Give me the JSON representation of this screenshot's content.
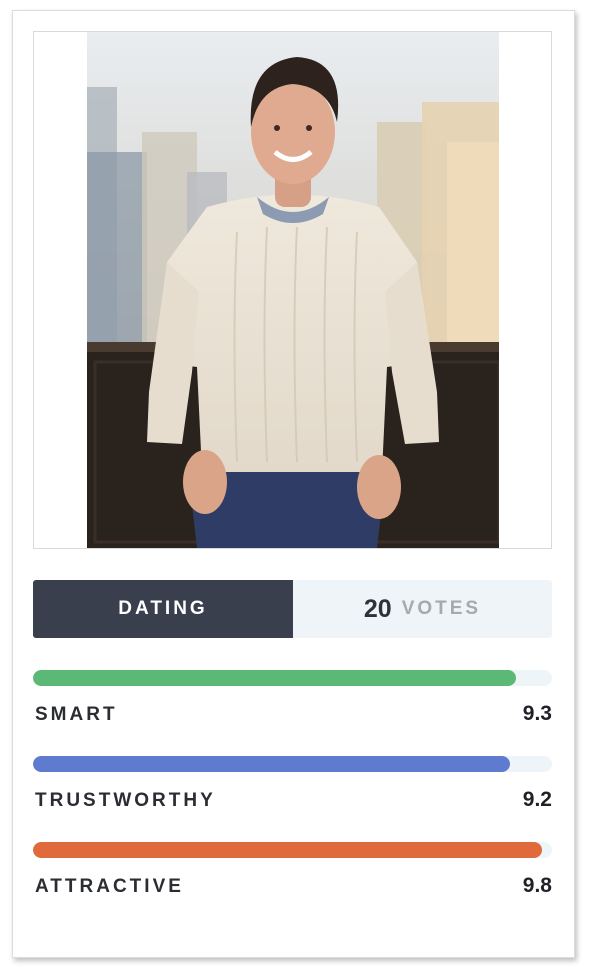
{
  "profile": {
    "photo_icon": "person-photo",
    "tabs": {
      "dating_label": "DATING",
      "votes_count": "20",
      "votes_label": "VOTES"
    },
    "metrics": [
      {
        "label": "SMART",
        "score": "9.3",
        "fill_percent": 93,
        "color": "#5cb975"
      },
      {
        "label": "TRUSTWORTHY",
        "score": "9.2",
        "fill_percent": 92,
        "color": "#5e7bd0"
      },
      {
        "label": "ATTRACTIVE",
        "score": "9.8",
        "fill_percent": 98,
        "color": "#e06a3b"
      }
    ]
  }
}
